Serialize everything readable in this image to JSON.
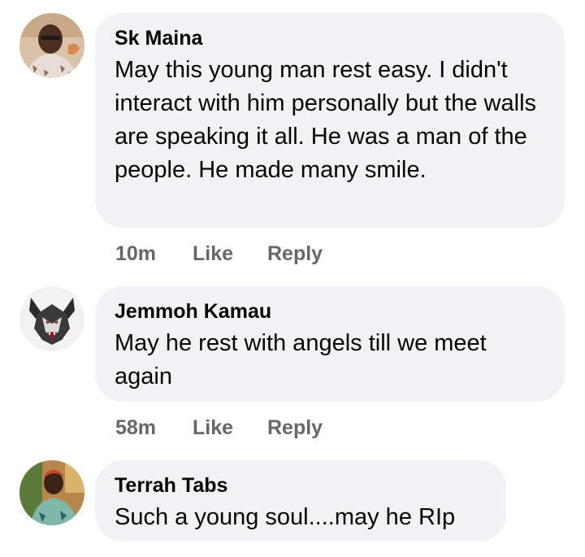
{
  "comments": [
    {
      "author": "Sk Maina",
      "avatar_icon": "user-avatar-photo",
      "text": "May this young man rest easy. I didn't interact with him personally but the walls are speaking it all. He was a man of the people. He made many smile.",
      "time": "10m",
      "like_label": "Like",
      "reply_label": "Reply"
    },
    {
      "author": "Jemmoh Kamau",
      "avatar_icon": "wolf-logo-avatar",
      "text": "May he rest with angels till we meet again",
      "time": "58m",
      "like_label": "Like",
      "reply_label": "Reply"
    },
    {
      "author": "Terrah Tabs",
      "avatar_icon": "user-avatar-photo",
      "text": "Such a young soul....may he RIp"
    }
  ],
  "colors": {
    "bubble_bg": "#f0f2f5",
    "action_text": "#65676b",
    "primary_text": "#050505"
  }
}
